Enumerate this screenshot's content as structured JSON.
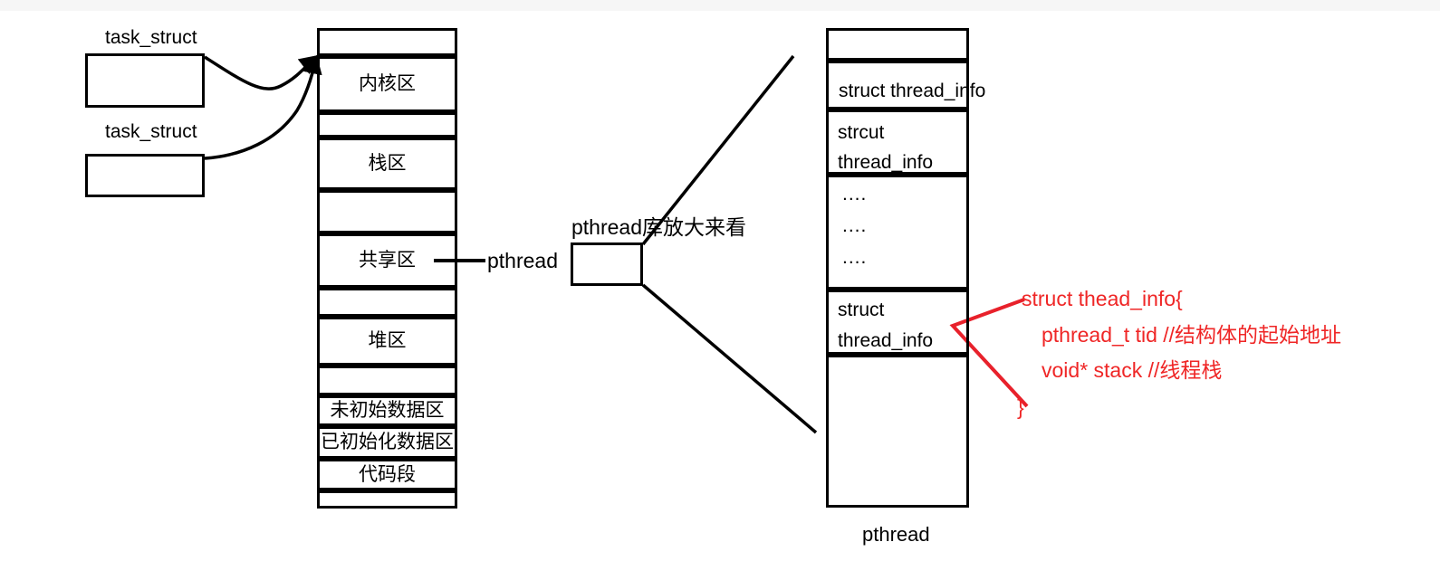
{
  "diagram": {
    "title": "pthread thread memory layout diagram",
    "colors": {
      "stroke": "#000000",
      "annotation_red": "#ef2626",
      "background": "#ffffff",
      "top_strip": "#f6f6f6"
    }
  },
  "task_structs": [
    {
      "label": "task_struct"
    },
    {
      "label": "task_struct"
    }
  ],
  "process_memory": {
    "regions": [
      {
        "label": "",
        "name": "region-blank-top"
      },
      {
        "label": "内核区",
        "name": "region-kernel"
      },
      {
        "label": "",
        "name": "region-gap-1"
      },
      {
        "label": "栈区",
        "name": "region-stack"
      },
      {
        "label": "",
        "name": "region-gap-2"
      },
      {
        "label": "共享区",
        "name": "region-shared"
      },
      {
        "label": "",
        "name": "region-gap-3"
      },
      {
        "label": "堆区",
        "name": "region-heap"
      },
      {
        "label": "",
        "name": "region-gap-4"
      },
      {
        "label": "未初始数据区",
        "name": "region-bss"
      },
      {
        "label": "已初始化数据区",
        "name": "region-data"
      },
      {
        "label": "代码段",
        "name": "region-text"
      },
      {
        "label": "",
        "name": "region-blank-bottom"
      }
    ]
  },
  "pthread_pointer": {
    "label": "pthread"
  },
  "pthread_lib": {
    "caption": "pthread库放大来看"
  },
  "pthread_detail": {
    "bottom_label": "pthread",
    "rows": [
      {
        "name": "detail-row-blank-top",
        "lines": []
      },
      {
        "name": "detail-row-struct-thread-info-1",
        "lines": [
          "struct thread_info"
        ]
      },
      {
        "name": "detail-row-strcut-thread-info",
        "lines": [
          "strcut",
          "thread_info"
        ]
      },
      {
        "name": "detail-row-ellipsis",
        "lines": [
          "....",
          "....",
          "...."
        ]
      },
      {
        "name": "detail-row-struct-thread-info-2",
        "lines": [
          "struct",
          "thread_info"
        ]
      },
      {
        "name": "detail-row-blank-bottom",
        "lines": []
      }
    ]
  },
  "annotation": {
    "lines": [
      "struct thead_info{",
      "pthread_t tid //结构体的起始地址",
      "void* stack  //线程栈",
      "}"
    ]
  }
}
